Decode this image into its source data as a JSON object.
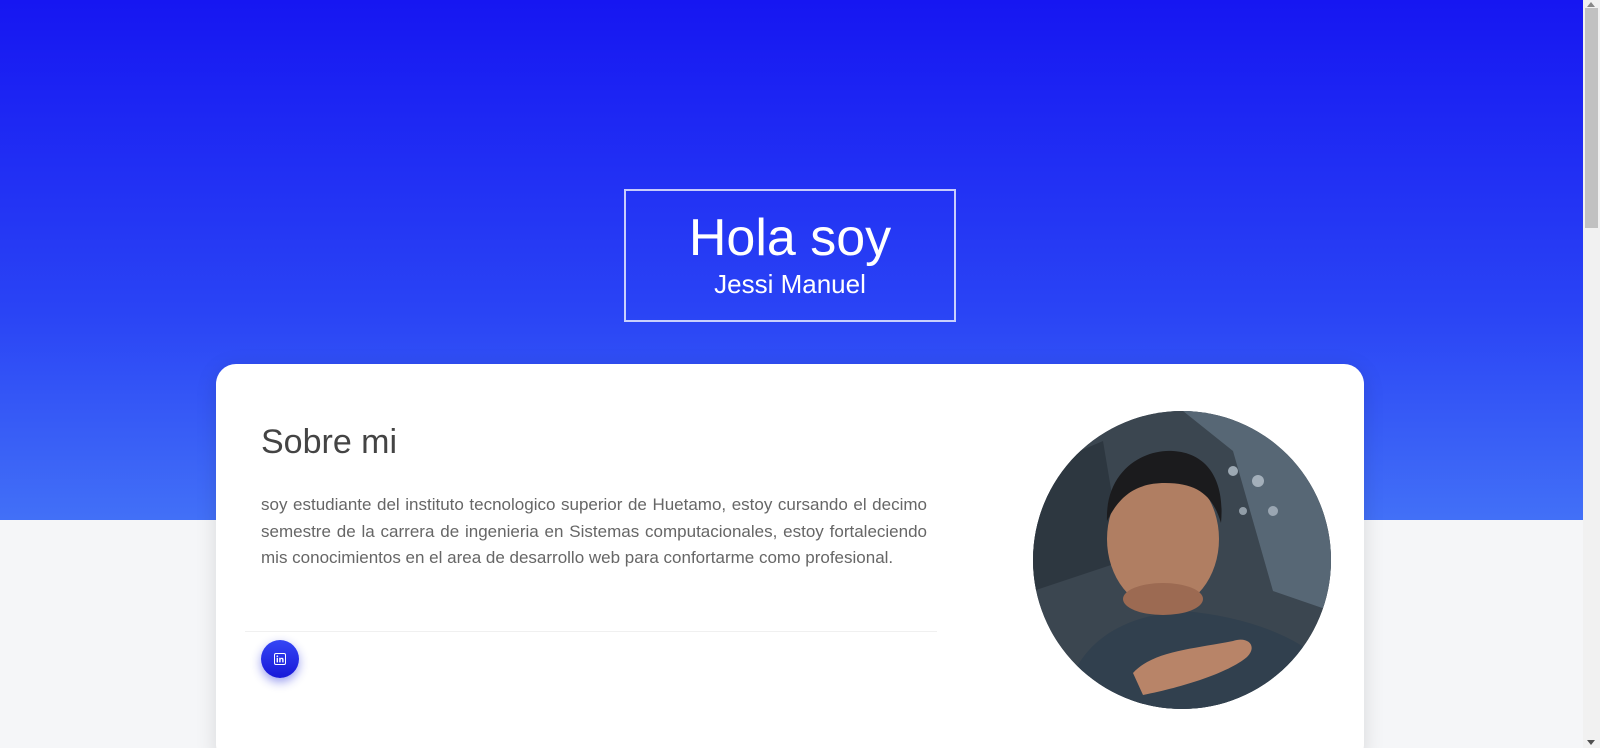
{
  "hero": {
    "title": "Hola soy",
    "name": "Jessi Manuel"
  },
  "about": {
    "heading": "Sobre mi",
    "text": "soy estudiante del instituto tecnologico superior de Huetamo, estoy cursando el decimo semestre de la carrera de ingenieria en Sistemas computacionales, estoy fortaleciendo mis conocimientos en el area de desarrollo web para confortarme como profesional.",
    "social": [
      {
        "icon": "linkedin-icon"
      }
    ],
    "photo_icon": "profile-photo"
  },
  "colors": {
    "hero_top": "#1616f2",
    "hero_bottom": "#4270f7",
    "accent": "#1f2ae8"
  }
}
